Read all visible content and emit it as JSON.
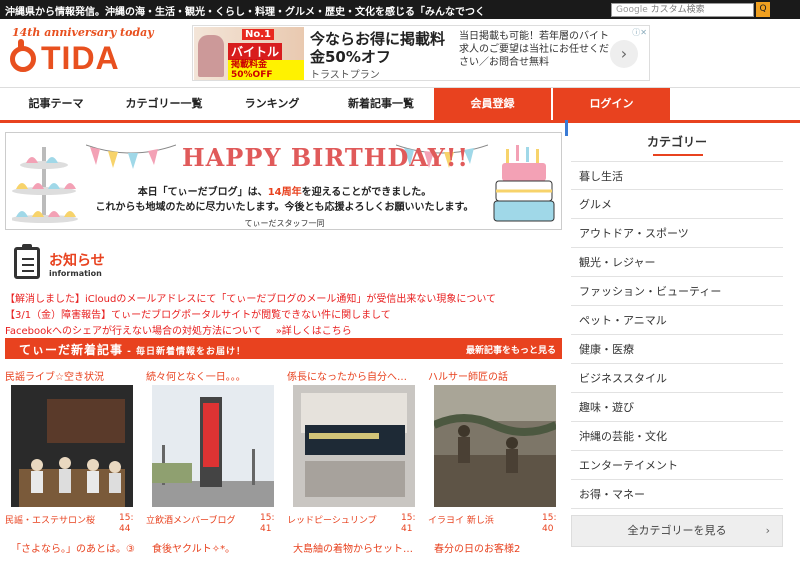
{
  "topbar": {
    "tagline": "沖縄県から情報発信。沖縄の海・生活・観光・くらし・料理・グルメ・歴史・文化を感じる「みんなでつく",
    "search_placeholder": "カスタム検索",
    "search_brand": "Google",
    "search_button": "Q"
  },
  "logo": {
    "anniversary": "14th anniversary today",
    "name": "TIDA"
  },
  "ad": {
    "badge_rank": "No.1",
    "badge_name": "バイトル",
    "badge_offer": "掲載料金 50%OFF",
    "headline": "今ならお得に掲載料金50%オフ",
    "brand": "トラストプラン",
    "body": "当日掲載も可能！若年層のバイト求人のご要望は当社にお任せください／お問合せ無料",
    "arrow": "›",
    "info": "ⓘ✕"
  },
  "nav": {
    "items": [
      "記事テーマ",
      "カテゴリー一覧",
      "ランキング",
      "新着記事一覧"
    ],
    "register": "会員登録",
    "login": "ログイン"
  },
  "banner": {
    "title": "HAPPY BIRTHDAY!!",
    "line1_pre": "本日「てぃーだブログ」は、",
    "line1_hl": "14周年",
    "line1_post": "を迎えることができました。",
    "line2": "これからも地域のために尽力いたします。今後とも応援よろしくお願いいたします。",
    "sign": "てぃーだスタッフ一同"
  },
  "notice": {
    "title": "お知らせ",
    "subtitle": "information",
    "items": [
      "【解消しました】iCloudのメールアドレスにて「てぃーだブログのメール通知」が受信出来ない現象について",
      "【3/1（金）障害報告】てぃーだブログポータルサイトが閲覧できない件に関しまして",
      "Facebookへのシェアが行えない場合の対処方法について"
    ],
    "more": "»詳しくはこちら"
  },
  "newposts": {
    "title": "てぃーだ新着記事",
    "subtitle": " - 毎日新着情報をお届け！",
    "more": "最新記事をもっと見る",
    "cards": [
      {
        "title": "民謡ライブ☆空き状況",
        "blog": "民謡・エステサロン桜",
        "time": "15:44"
      },
      {
        "title": "続々何となく一日。。。",
        "blog": "立飲酒メンバーブログ",
        "time": "15:41"
      },
      {
        "title": "係長になったから自分へ…",
        "blog": "レッドピーシュリンプ",
        "time": "15:41"
      },
      {
        "title": "ハルサー師匠の話",
        "blog": "イラヨイ 新し浜",
        "time": "15:40"
      }
    ],
    "row2": [
      "「さよなら。」のあとは。③",
      "食後ヤクルト✧*｡",
      "大島紬の着物からセット…",
      "春分の日のお客様2"
    ]
  },
  "categories": {
    "title": "カテゴリー",
    "items": [
      "暮し生活",
      "グルメ",
      "アウトドア・スポーツ",
      "観光・レジャー",
      "ファッション・ビューティー",
      "ペット・アニマル",
      "健康・医療",
      "ビジネススタイル",
      "趣味・遊び",
      "沖縄の芸能・文化",
      "エンターテイメント",
      "お得・マネー"
    ],
    "all_button": "全カテゴリーを見る",
    "chevron": "›"
  },
  "colors": {
    "accent": "#e8421f",
    "notice_red": "#e81f1f"
  }
}
